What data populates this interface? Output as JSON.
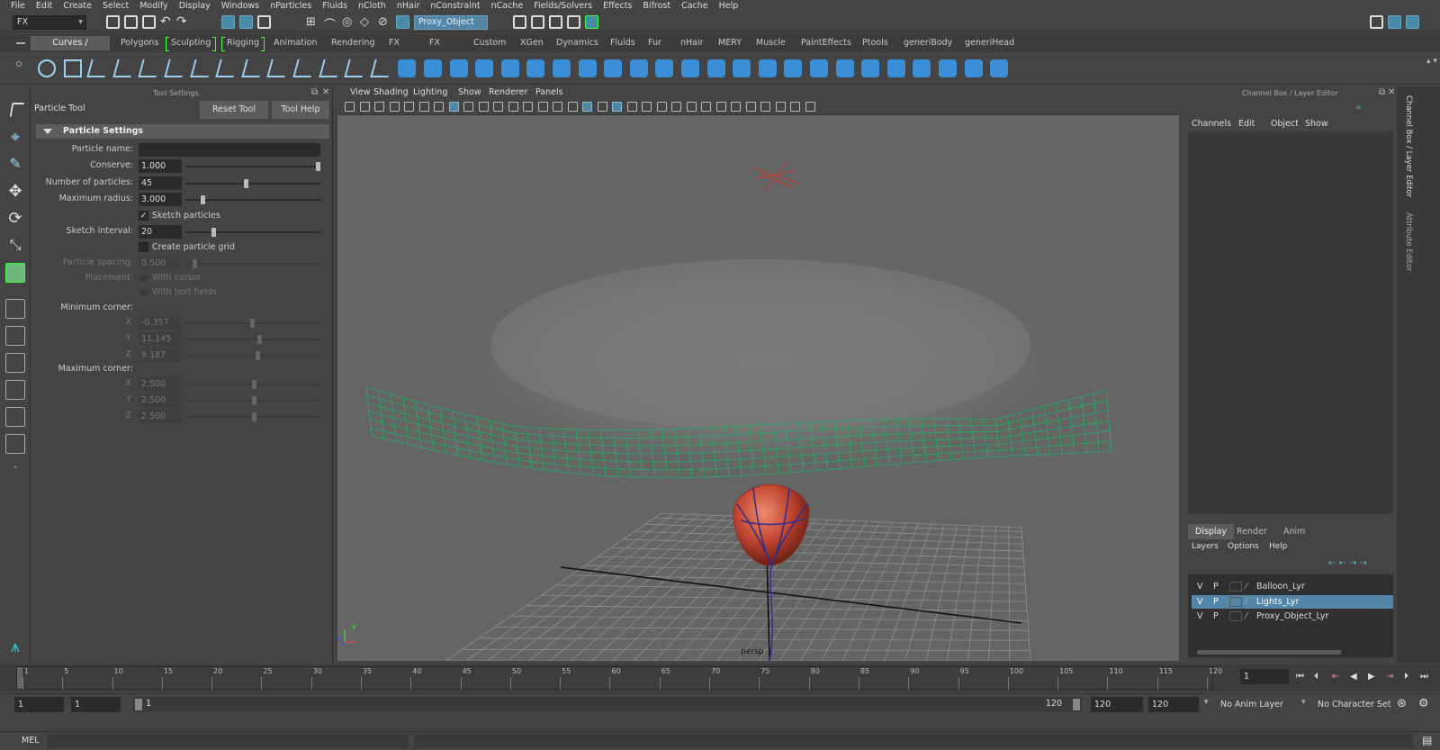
{
  "menu": [
    "File",
    "Edit",
    "Create",
    "Select",
    "Modify",
    "Display",
    "Windows",
    "nParticles",
    "Fluids",
    "nCloth",
    "nHair",
    "nConstraint",
    "nCache",
    "Fields/Solvers",
    "Effects",
    "Bifrost",
    "Cache",
    "Help"
  ],
  "status": {
    "menuset": "FX",
    "selection_field": "Proxy_Object"
  },
  "shelf_tabs": [
    "Curves / Surfaces",
    "Polygons",
    "Sculpting",
    "Rigging",
    "Animation",
    "Rendering",
    "FX",
    "FX Caching",
    "Custom",
    "XGen",
    "Dynamics",
    "Fluids",
    "Fur",
    "nHair",
    "MERY",
    "Muscle",
    "PaintEffects",
    "Ptools",
    "generiBody",
    "generiHead"
  ],
  "tool_settings": {
    "header": "Tool Settings",
    "tool_name": "Particle Tool",
    "reset_label": "Reset Tool",
    "help_label": "Tool Help",
    "section": "Particle Settings",
    "particle_name_label": "Particle name:",
    "particle_name": "",
    "conserve_label": "Conserve:",
    "conserve": "1.000",
    "conserve_level": 1.0,
    "num_particles_label": "Number of particles:",
    "num_particles": "45",
    "num_particles_level": 0.45,
    "max_radius_label": "Maximum radius:",
    "max_radius": "3.000",
    "max_radius_level": 0.12,
    "sketch_particles_label": "Sketch particles",
    "sketch_particles_checked": true,
    "sketch_interval_label": "Sketch interval:",
    "sketch_interval": "20",
    "sketch_interval_level": 0.2,
    "grid_label": "Create particle grid",
    "grid_checked": false,
    "spacing_label": "Particle spacing:",
    "spacing": "0.500",
    "placement_label": "Placement:",
    "with_cursor": "With cursor",
    "with_text": "With text fields",
    "min_corner_label": "Minimum corner:",
    "min": [
      {
        "axis": "X",
        "value": "-0.357"
      },
      {
        "axis": "Y",
        "value": "11.145"
      },
      {
        "axis": "Z",
        "value": "9.187"
      }
    ],
    "max_corner_label": "Maximum corner:",
    "max": [
      {
        "axis": "X",
        "value": "2.500"
      },
      {
        "axis": "Y",
        "value": "2.500"
      },
      {
        "axis": "Z",
        "value": "2.500"
      }
    ]
  },
  "viewport": {
    "menu": [
      "View",
      "Shading",
      "Lighting",
      "Show",
      "Renderer",
      "Panels"
    ],
    "camera_label": "persp"
  },
  "channel_box": {
    "header": "Channel Box / Layer Editor",
    "menu": [
      "Channels",
      "Edit",
      "Object",
      "Show"
    ],
    "layer_tabs": [
      "Display",
      "Render",
      "Anim"
    ],
    "layer_menu": [
      "Layers",
      "Options",
      "Help"
    ],
    "layers": [
      {
        "v": "V",
        "p": "P",
        "name": "Balloon_Lyr",
        "selected": false
      },
      {
        "v": "V",
        "p": "P",
        "name": "Lights_Lyr",
        "selected": true
      },
      {
        "v": "V",
        "p": "P",
        "name": "Proxy_Object_Lyr",
        "selected": false
      }
    ],
    "side_tabs": [
      "Channel Box / Layer Editor",
      "Attribute Editor"
    ]
  },
  "timeline": {
    "ticks": [
      "1",
      "5",
      "10",
      "15",
      "20",
      "25",
      "30",
      "35",
      "40",
      "45",
      "50",
      "55",
      "60",
      "65",
      "70",
      "75",
      "80",
      "85",
      "90",
      "95",
      "100",
      "105",
      "110",
      "115",
      "120"
    ],
    "current_frame": "1",
    "range_start": "1",
    "range_start2": "1",
    "range_inner_start": "1",
    "range_inner_end": "120",
    "range_end": "120",
    "range_end2": "120",
    "anim_layer": "No Anim Layer",
    "char_set": "No Character Set"
  },
  "cmdline": {
    "label": "MEL"
  },
  "colors": {
    "accent": "#5285a6",
    "grid_green": "#2aa66b",
    "balloon": "#c8503a",
    "cursor_red": "#c0392b"
  }
}
